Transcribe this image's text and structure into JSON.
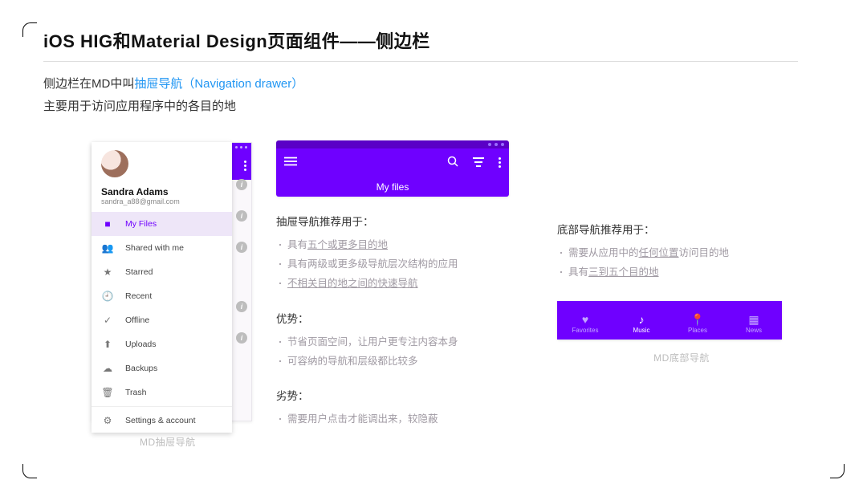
{
  "title": "iOS HIG和Material Design页面组件——侧边栏",
  "intro": {
    "l1a": "侧边栏在MD中叫",
    "l1b": "抽屉导航（Navigation drawer）",
    "l2": "主要用于访问应用程序中的各目的地"
  },
  "drawer": {
    "user_name": "Sandra Adams",
    "user_email": "sandra_a88@gmail.com",
    "items": [
      {
        "icon": "folder-icon",
        "glyph": "■",
        "label": "My Files",
        "active": true
      },
      {
        "icon": "people-icon",
        "glyph": "👥",
        "label": "Shared with me"
      },
      {
        "icon": "star-icon",
        "glyph": "★",
        "label": "Starred"
      },
      {
        "icon": "clock-icon",
        "glyph": "🕘",
        "label": "Recent"
      },
      {
        "icon": "offline-icon",
        "glyph": "✓",
        "label": "Offline"
      },
      {
        "icon": "upload-icon",
        "glyph": "⬆",
        "label": "Uploads"
      },
      {
        "icon": "cloud-icon",
        "glyph": "☁",
        "label": "Backups"
      },
      {
        "icon": "trash-icon",
        "glyph": "🗑",
        "label": "Trash"
      },
      {
        "icon": "gear-icon",
        "glyph": "⚙",
        "label": "Settings & account"
      }
    ],
    "caption": "MD抽屉导航"
  },
  "myfiles": {
    "label": "My files"
  },
  "drawer_rec": {
    "heading": "抽屉导航推荐用于：",
    "bullets": [
      {
        "pre": "具有",
        "ul": "五个或更多目的地",
        "post": ""
      },
      {
        "pre": "具有两级或更多级导航层次结构的应用",
        "ul": "",
        "post": ""
      },
      {
        "pre": "",
        "ul": "不相关目的地之间的快速导航",
        "post": ""
      }
    ]
  },
  "pros": {
    "heading": "优势：",
    "bullets": [
      {
        "pre": "节省页面空间，让用户更专注内容本身",
        "ul": "",
        "post": ""
      },
      {
        "pre": "可容纳的导航和层级都比较多",
        "ul": "",
        "post": ""
      }
    ]
  },
  "cons": {
    "heading": "劣势：",
    "bullets": [
      {
        "pre": "需要用户点击才能调出来，较隐蔽",
        "ul": "",
        "post": ""
      }
    ]
  },
  "bottom_rec": {
    "heading": "底部导航推荐用于：",
    "bullets": [
      {
        "pre": "需要从应用中的",
        "ul": "任何位置",
        "post": "访问目的地"
      },
      {
        "pre": "具有",
        "ul": "三到五个目的地",
        "post": ""
      }
    ]
  },
  "bottom_nav": {
    "items": [
      {
        "icon": "heart-icon",
        "glyph": "♥",
        "label": "Favorites"
      },
      {
        "icon": "music-icon",
        "glyph": "♪",
        "label": "Music",
        "active": true
      },
      {
        "icon": "place-icon",
        "glyph": "📍",
        "label": "Places"
      },
      {
        "icon": "news-icon",
        "glyph": "▦",
        "label": "News"
      }
    ],
    "caption": "MD底部导航"
  },
  "info_dot": "i"
}
